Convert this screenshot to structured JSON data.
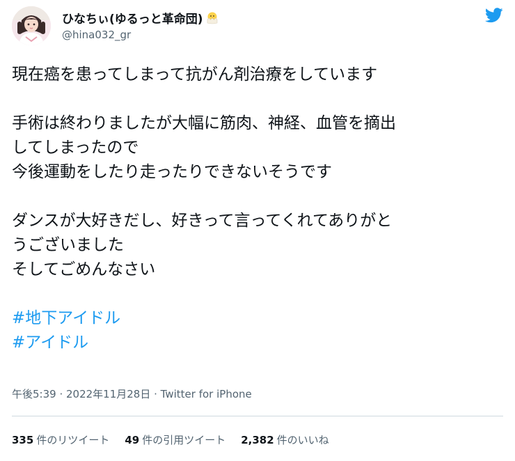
{
  "user": {
    "display_name": "ひなちぃ(ゆるっと革命団)",
    "emoji_icon": "hatching-chick-icon",
    "handle": "@hina032_gr"
  },
  "brand": {
    "logo_icon": "twitter-bird-icon",
    "accent_color": "#1d9bf0"
  },
  "tweet": {
    "lines": [
      "現在癌を患ってしまって抗がん剤治療をしています",
      "",
      "手術は終わりましたが大幅に筋肉、神経、血管を摘出",
      "してしまったので",
      "今後運動をしたり走ったりできないそうです",
      "",
      "ダンスが大好きだし、好きって言ってくれてありがと",
      "うございました",
      "そしてごめんなさい",
      ""
    ],
    "hashtags": [
      "#地下アイドル",
      "#アイドル"
    ]
  },
  "meta": {
    "time": "午後5:39",
    "separator": " · ",
    "date": "2022年11月28日",
    "source": "Twitter for iPhone"
  },
  "stats": [
    {
      "count": "335",
      "label": "件のリツイート"
    },
    {
      "count": "49",
      "label": "件の引用ツイート"
    },
    {
      "count": "2,382",
      "label": "件のいいね"
    }
  ]
}
